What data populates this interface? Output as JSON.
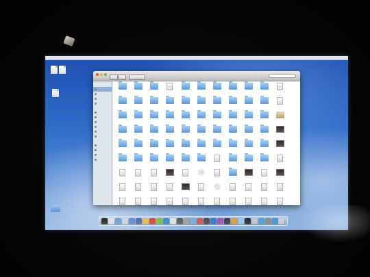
{
  "menubar": {
    "apple_glyph": "",
    "clock_text": ""
  },
  "window": {
    "title": "",
    "search_placeholder": ""
  },
  "sidebar": {
    "sections": [
      {
        "heading": "",
        "items": [
          "",
          "",
          "",
          ""
        ]
      },
      {
        "heading": "",
        "items": [
          "",
          "",
          "",
          "",
          "",
          ""
        ]
      },
      {
        "heading": "",
        "items": [
          "",
          "",
          "",
          ""
        ]
      }
    ]
  },
  "files": {
    "rows": [
      [
        "folder",
        "folder",
        "folder",
        "doc",
        "folder",
        "folder",
        "folder",
        "folder",
        "folder",
        "folder",
        "doc"
      ],
      [
        "folder",
        "folder",
        "folder",
        "folder",
        "folder",
        "folder",
        "folder",
        "folder",
        "folder",
        "folder",
        "doc"
      ],
      [
        "folder",
        "folder",
        "folder",
        "folder",
        "folder",
        "folder",
        "folder",
        "folder",
        "folder",
        "folder",
        "pkg"
      ],
      [
        "folder",
        "folder",
        "folder",
        "folder",
        "folder",
        "folder",
        "folder",
        "folder",
        "folder",
        "folder",
        "img"
      ],
      [
        "folder",
        "folder",
        "folder",
        "folder",
        "folder",
        "folder",
        "folder",
        "folder",
        "folder",
        "folder",
        "img"
      ],
      [
        "folder",
        "folder",
        "folder",
        "folder",
        "folder",
        "folder",
        "doc",
        "folder",
        "folder",
        "folder",
        "doc"
      ],
      [
        "doc",
        "doc",
        "doc",
        "img",
        "doc",
        "cd",
        "doc",
        "folder",
        "img",
        "doc",
        "img"
      ],
      [
        "doc",
        "doc",
        "doc",
        "doc",
        "img",
        "doc",
        "cd",
        "doc",
        "doc",
        "doc",
        "doc"
      ],
      [
        "doc",
        "doc",
        "doc",
        "doc",
        "doc",
        "doc",
        "doc",
        "doc",
        "doc",
        "doc",
        "doc"
      ]
    ]
  },
  "dock": {
    "colors": [
      "#2b2b2b",
      "#e0e6f0",
      "#6f9fd8",
      "#d2d8e2",
      "#5f8fd0",
      "#4c6ea8",
      "#e8c24a",
      "#d24a3a",
      "#7bbf4a",
      "#3a8ad0",
      "#e6e6e6",
      "#5a5a5a",
      "#a0a0a0",
      "#6ab0e8",
      "#d9534f",
      "#4a4a4a",
      "#2d78c8",
      "#b04ac0",
      "#3b3b3b",
      "#e0a030",
      "#9cc9ee",
      "#2a2a2a",
      "#c8c8c8",
      "#4aa0e0",
      "#8a8a8a",
      "#3a9ad8",
      "#d0d0d0"
    ]
  }
}
